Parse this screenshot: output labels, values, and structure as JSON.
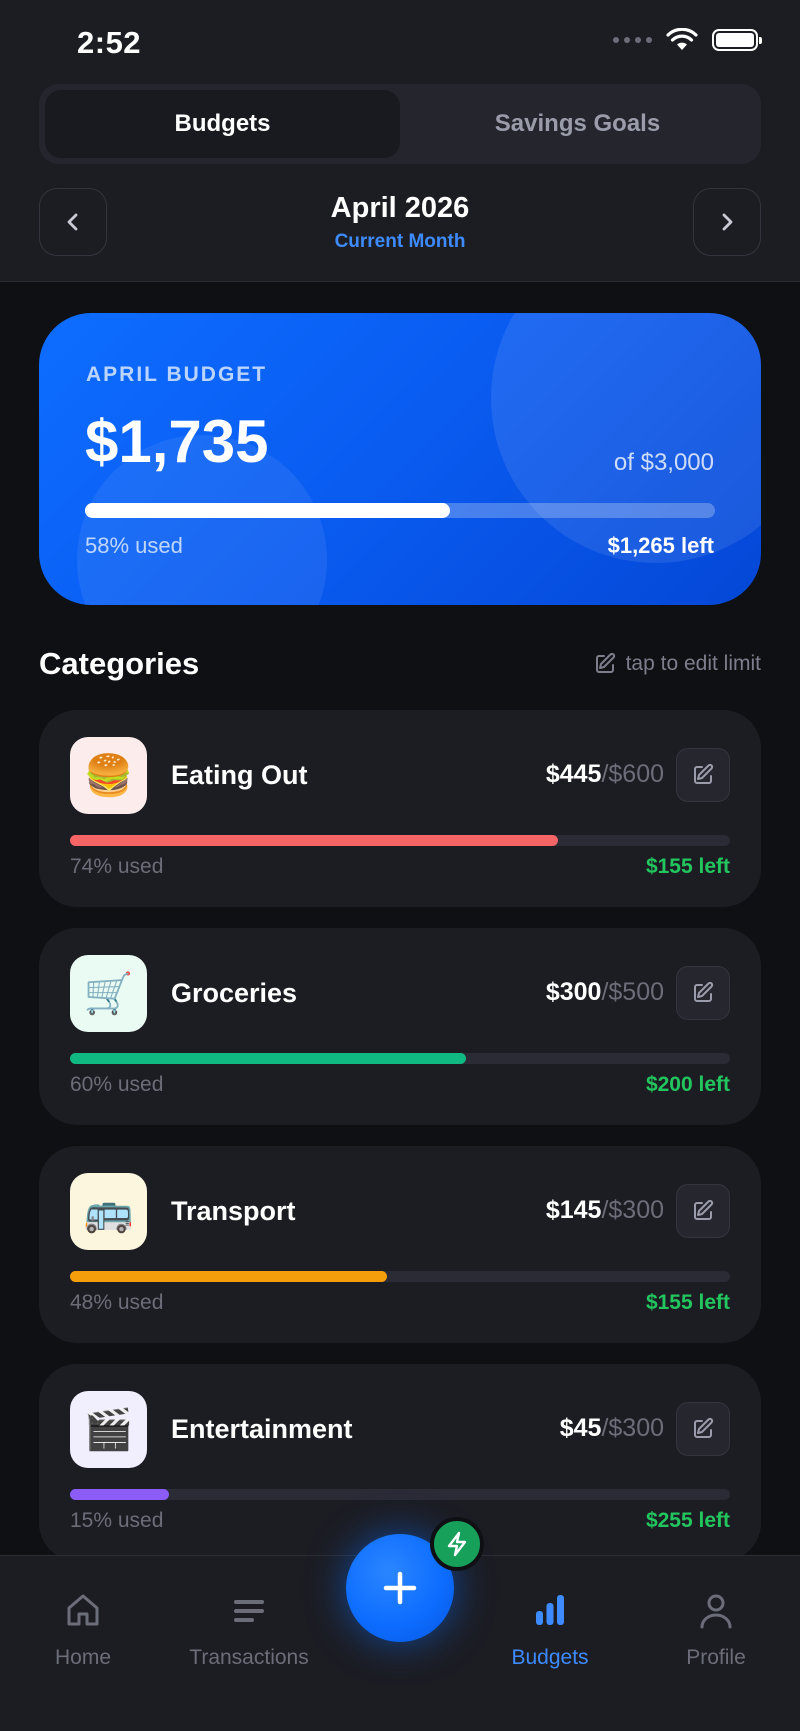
{
  "status_bar": {
    "time": "2:52"
  },
  "segmented": {
    "tabs": [
      "Budgets",
      "Savings Goals"
    ],
    "active": 0
  },
  "month_nav": {
    "month": "April 2026",
    "subtitle": "Current Month"
  },
  "summary": {
    "label": "APRIL BUDGET",
    "spent": "$1,735",
    "of_total": "of $3,000",
    "progress": 0.58,
    "used_text": "58% used",
    "left_text": "$1,265 left"
  },
  "categories_section": {
    "title": "Categories",
    "hint": "tap to edit limit"
  },
  "categories": [
    {
      "name": "Eating Out",
      "emoji": "🍔",
      "spent": "$445",
      "limit": "/$600",
      "progress": 0.74,
      "used": "74% used",
      "left": "$155 left",
      "color": "#f56565",
      "icon_bg": "#fdecec"
    },
    {
      "name": "Groceries",
      "emoji": "🛒",
      "spent": "$300",
      "limit": "/$500",
      "progress": 0.6,
      "used": "60% used",
      "left": "$200 left",
      "color": "#10b981",
      "icon_bg": "#e9fbf2"
    },
    {
      "name": "Transport",
      "emoji": "🚌",
      "spent": "$145",
      "limit": "/$300",
      "progress": 0.48,
      "used": "48% used",
      "left": "$155 left",
      "color": "#f59e0b",
      "icon_bg": "#fdf6df"
    },
    {
      "name": "Entertainment",
      "emoji": "🎬",
      "spent": "$45",
      "limit": "/$300",
      "progress": 0.15,
      "used": "15% used",
      "left": "$255 left",
      "color": "#8b5cf6",
      "icon_bg": "#f1eefd"
    }
  ],
  "tabbar": {
    "items": [
      {
        "label": "Home",
        "icon": "home-icon"
      },
      {
        "label": "Transactions",
        "icon": "list-icon"
      },
      {
        "label": "Budgets",
        "icon": "bar-chart-icon"
      },
      {
        "label": "Profile",
        "icon": "user-icon"
      }
    ],
    "active": 2
  },
  "colors": {
    "accent": "#3d8bff",
    "positive": "#22c55e",
    "card": "#1c1d23",
    "background": "#0f1014"
  }
}
